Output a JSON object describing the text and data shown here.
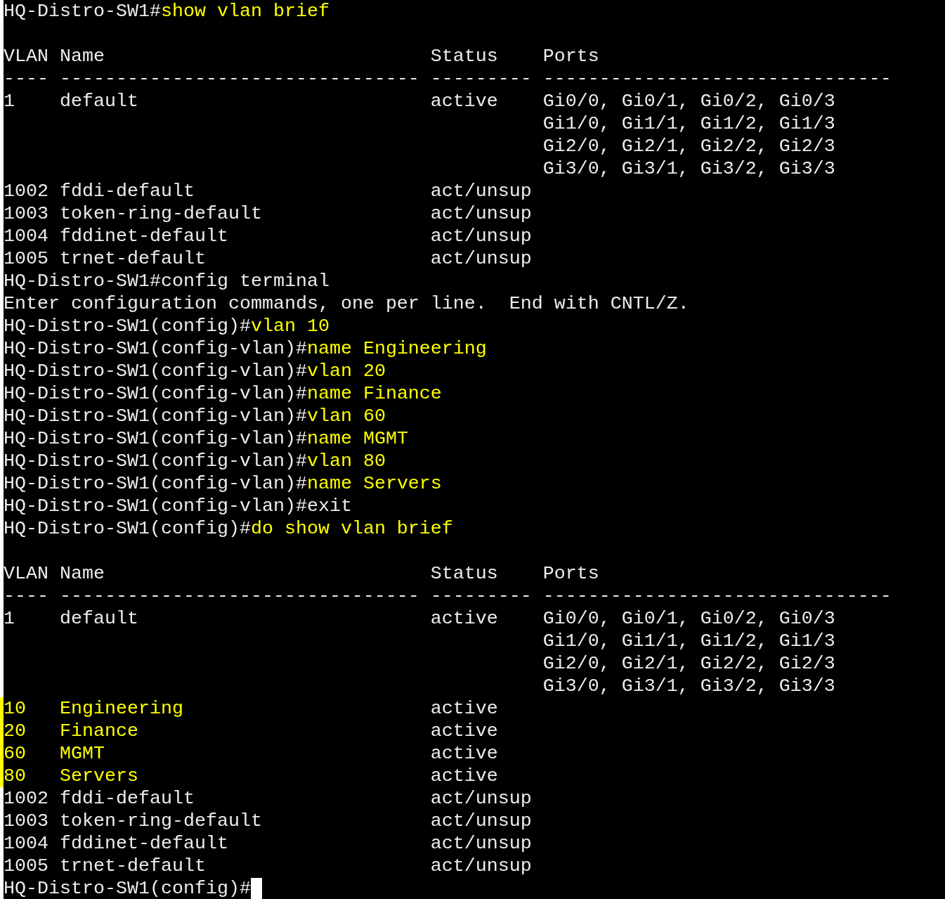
{
  "terminal": {
    "blocks": [
      {
        "kind": "command",
        "prompt": "HQ-Distro-SW1#",
        "input": "show vlan brief",
        "highlighted": true
      },
      {
        "kind": "blank"
      },
      {
        "kind": "vlan_table",
        "columns": [
          {
            "title": "VLAN",
            "rule": "----"
          },
          {
            "title": "Name",
            "rule": "--------------------------------"
          },
          {
            "title": "Status",
            "rule": "---------"
          },
          {
            "title": "Ports",
            "rule": "-------------------------------"
          }
        ],
        "rows": [
          {
            "vlan": "1",
            "name": "default",
            "status": "active",
            "ports": [
              "Gi0/0, Gi0/1, Gi0/2, Gi0/3",
              "Gi1/0, Gi1/1, Gi1/2, Gi1/3",
              "Gi2/0, Gi2/1, Gi2/2, Gi2/3",
              "Gi3/0, Gi3/1, Gi3/2, Gi3/3"
            ],
            "highlighted": false
          },
          {
            "vlan": "1002",
            "name": "fddi-default",
            "status": "act/unsup",
            "ports": [],
            "highlighted": false
          },
          {
            "vlan": "1003",
            "name": "token-ring-default",
            "status": "act/unsup",
            "ports": [],
            "highlighted": false
          },
          {
            "vlan": "1004",
            "name": "fddinet-default",
            "status": "act/unsup",
            "ports": [],
            "highlighted": false
          },
          {
            "vlan": "1005",
            "name": "trnet-default",
            "status": "act/unsup",
            "ports": [],
            "highlighted": false
          }
        ]
      },
      {
        "kind": "command",
        "prompt": "HQ-Distro-SW1#",
        "input": "config terminal",
        "highlighted": false
      },
      {
        "kind": "message",
        "text": "Enter configuration commands, one per line.  End with CNTL/Z."
      },
      {
        "kind": "command",
        "prompt": "HQ-Distro-SW1(config)#",
        "input": "vlan 10",
        "highlighted": true
      },
      {
        "kind": "command",
        "prompt": "HQ-Distro-SW1(config-vlan)#",
        "input": "name Engineering",
        "highlighted": true
      },
      {
        "kind": "command",
        "prompt": "HQ-Distro-SW1(config-vlan)#",
        "input": "vlan 20",
        "highlighted": true
      },
      {
        "kind": "command",
        "prompt": "HQ-Distro-SW1(config-vlan)#",
        "input": "name Finance",
        "highlighted": true
      },
      {
        "kind": "command",
        "prompt": "HQ-Distro-SW1(config-vlan)#",
        "input": "vlan 60",
        "highlighted": true
      },
      {
        "kind": "command",
        "prompt": "HQ-Distro-SW1(config-vlan)#",
        "input": "name MGMT",
        "highlighted": true
      },
      {
        "kind": "command",
        "prompt": "HQ-Distro-SW1(config-vlan)#",
        "input": "vlan 80",
        "highlighted": true
      },
      {
        "kind": "command",
        "prompt": "HQ-Distro-SW1(config-vlan)#",
        "input": "name Servers",
        "highlighted": true
      },
      {
        "kind": "command",
        "prompt": "HQ-Distro-SW1(config-vlan)#",
        "input": "exit",
        "highlighted": false
      },
      {
        "kind": "command",
        "prompt": "HQ-Distro-SW1(config)#",
        "input": "do show vlan brief",
        "highlighted": true
      },
      {
        "kind": "blank"
      },
      {
        "kind": "vlan_table",
        "columns": [
          {
            "title": "VLAN",
            "rule": "----"
          },
          {
            "title": "Name",
            "rule": "--------------------------------"
          },
          {
            "title": "Status",
            "rule": "---------"
          },
          {
            "title": "Ports",
            "rule": "-------------------------------"
          }
        ],
        "rows": [
          {
            "vlan": "1",
            "name": "default",
            "status": "active",
            "ports": [
              "Gi0/0, Gi0/1, Gi0/2, Gi0/3",
              "Gi1/0, Gi1/1, Gi1/2, Gi1/3",
              "Gi2/0, Gi2/1, Gi2/2, Gi2/3",
              "Gi3/0, Gi3/1, Gi3/2, Gi3/3"
            ],
            "highlighted": false
          },
          {
            "vlan": "10",
            "name": "Engineering",
            "status": "active",
            "ports": [],
            "highlighted": true
          },
          {
            "vlan": "20",
            "name": "Finance",
            "status": "active",
            "ports": [],
            "highlighted": true
          },
          {
            "vlan": "60",
            "name": "MGMT",
            "status": "active",
            "ports": [],
            "highlighted": true
          },
          {
            "vlan": "80",
            "name": "Servers",
            "status": "active",
            "ports": [],
            "highlighted": true
          },
          {
            "vlan": "1002",
            "name": "fddi-default",
            "status": "act/unsup",
            "ports": [],
            "highlighted": false
          },
          {
            "vlan": "1003",
            "name": "token-ring-default",
            "status": "act/unsup",
            "ports": [],
            "highlighted": false
          },
          {
            "vlan": "1004",
            "name": "fddinet-default",
            "status": "act/unsup",
            "ports": [],
            "highlighted": false
          },
          {
            "vlan": "1005",
            "name": "trnet-default",
            "status": "act/unsup",
            "ports": [],
            "highlighted": false
          }
        ]
      },
      {
        "kind": "command",
        "prompt": "HQ-Distro-SW1(config)#",
        "cursor": true
      }
    ]
  }
}
